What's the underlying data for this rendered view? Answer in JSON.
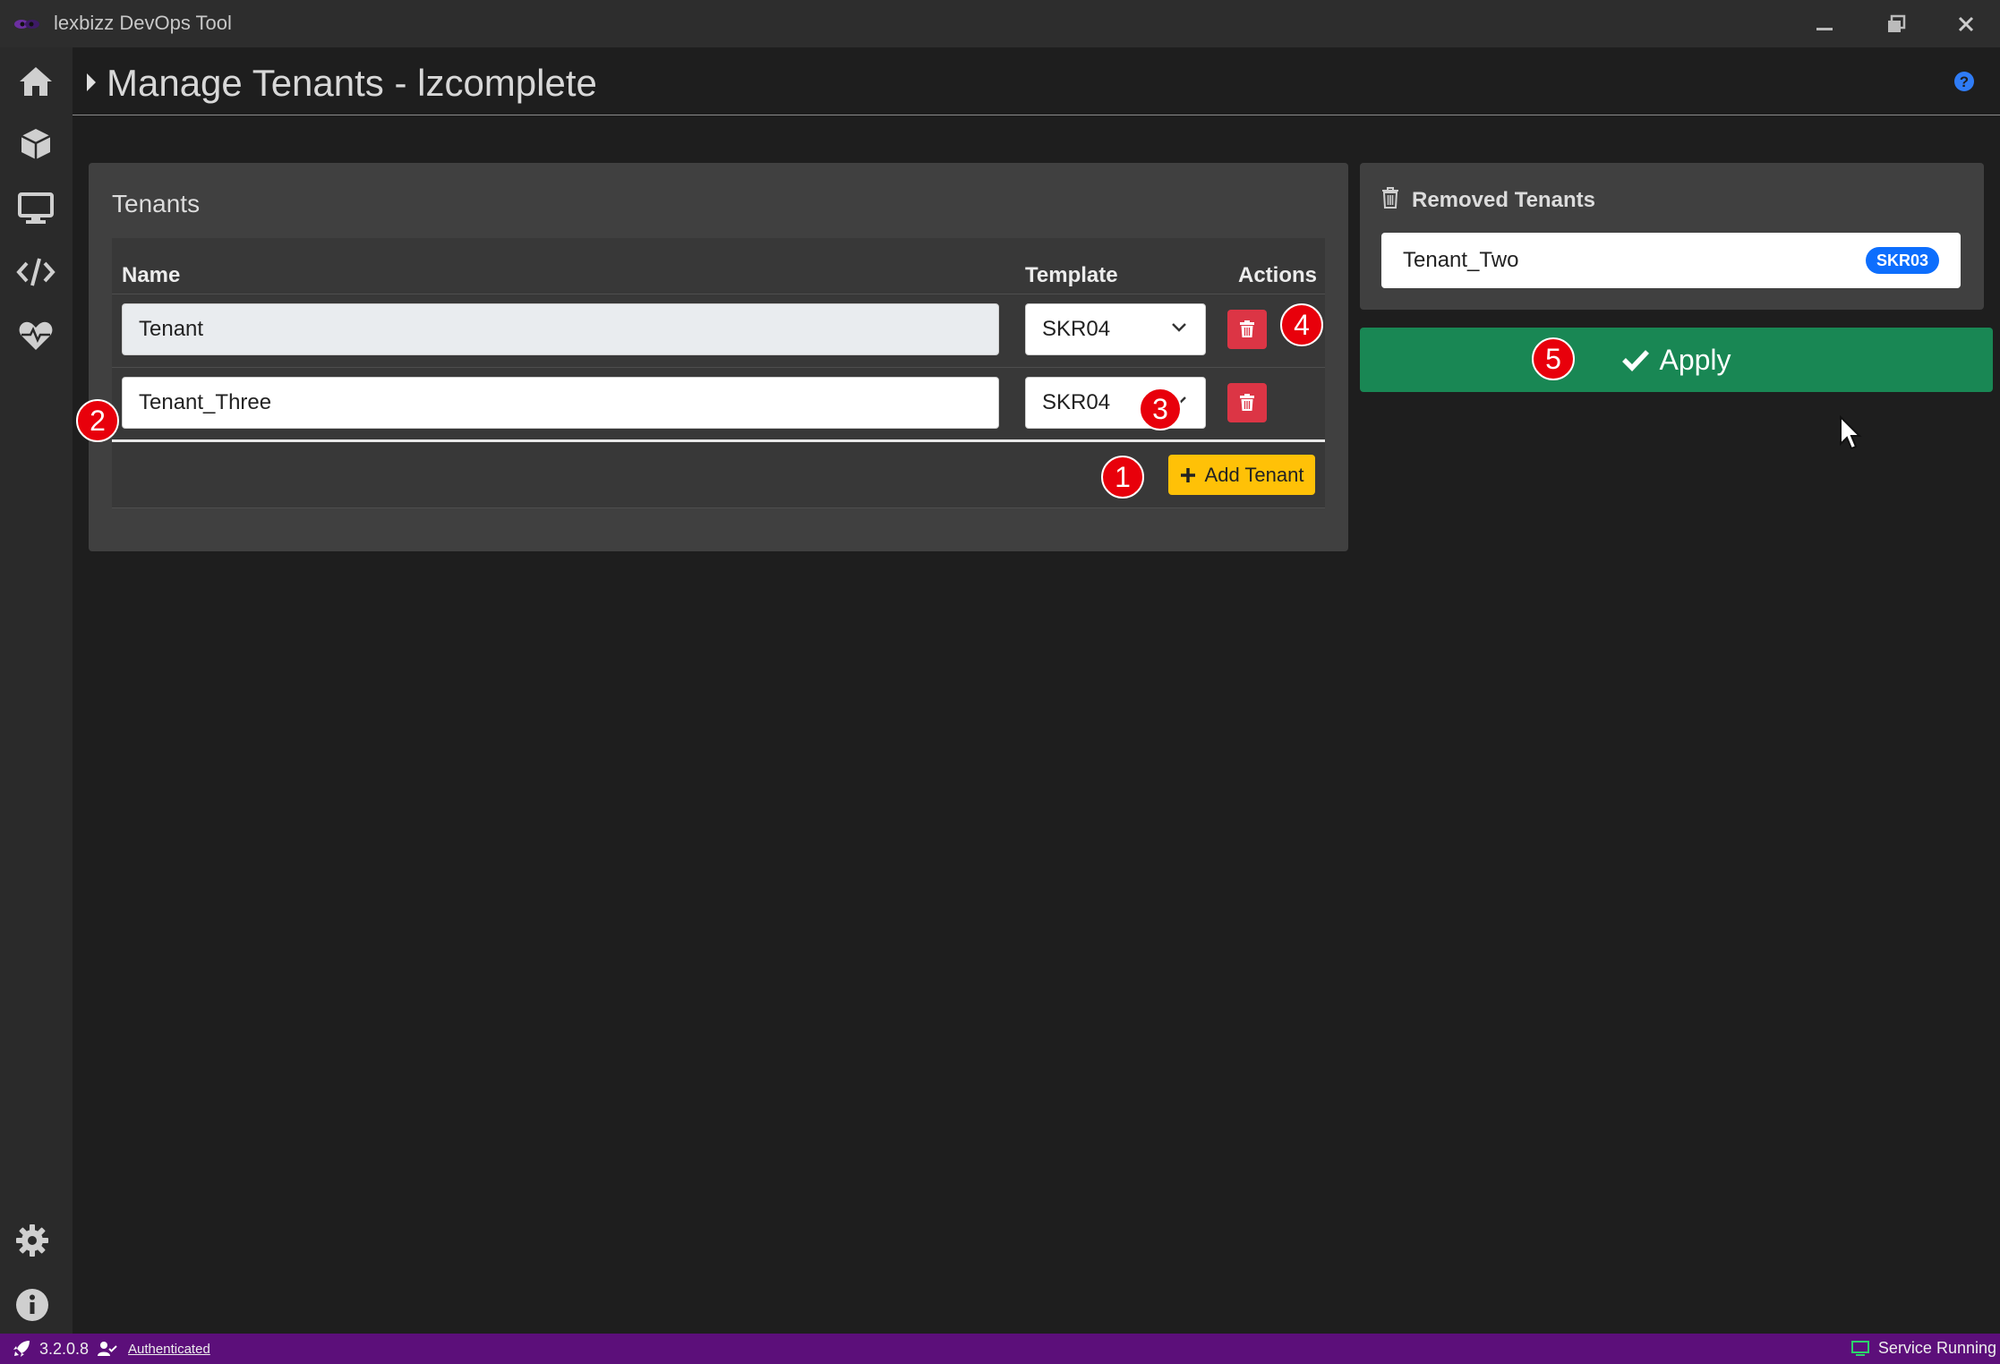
{
  "window": {
    "title": "lexbizz DevOps Tool"
  },
  "header": {
    "title": "Manage Tenants - lzcomplete"
  },
  "tenants_card": {
    "title": "Tenants",
    "columns": [
      "Name",
      "Template",
      "Actions"
    ],
    "rows": [
      {
        "name": "Tenant",
        "template": "SKR04"
      },
      {
        "name": "Tenant_Three",
        "template": "SKR04"
      }
    ],
    "add_button_label": "Add Tenant"
  },
  "removed_card": {
    "title": "Removed Tenants",
    "items": [
      {
        "name": "Tenant_Two",
        "template": "SKR03"
      }
    ]
  },
  "apply_button_label": "Apply",
  "markers": [
    "1",
    "2",
    "3",
    "4",
    "5"
  ],
  "statusbar": {
    "version": "3.2.0.8",
    "auth": "Authenticated",
    "service": "Service Running"
  },
  "colors": {
    "statusbar": "#5c0f7a",
    "apply": "#198754",
    "add": "#ffc107",
    "delete": "#dc3545",
    "badge": "#0d6efd",
    "marker": "#e8000b"
  }
}
